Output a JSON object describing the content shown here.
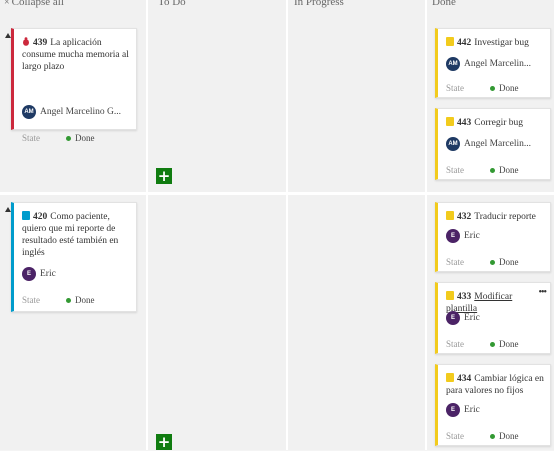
{
  "header": {
    "collapse_all": "Collapse all",
    "collapse_icon": "×",
    "columns": [
      "To Do",
      "In Progress",
      "Done"
    ]
  },
  "state_label": "State",
  "colors": {
    "bug": "#cc293d",
    "story": "#009ccc",
    "task": "#f2cb1d",
    "done_dot": "#339933",
    "add_button": "#107c10"
  },
  "rows": [
    {
      "parent": {
        "type": "bug",
        "icon": "bug-icon",
        "id": "439",
        "title": "La aplicación consume mucha memoria al largo plazo",
        "assignee_initials": "AM",
        "assignee": "Angel Marcelino G...",
        "state": "Done"
      },
      "done": [
        {
          "id": "442",
          "title": "Investigar bug",
          "initials": "AM",
          "assignee": "Angel Marcelin...",
          "state": "Done"
        },
        {
          "id": "443",
          "title": "Corregir bug",
          "initials": "AM",
          "assignee": "Angel Marcelin...",
          "state": "Done"
        }
      ]
    },
    {
      "parent": {
        "type": "story",
        "icon": "book-icon",
        "id": "420",
        "title": "Como paciente, quiero que mi reporte de resultado esté también en inglés",
        "assignee_initials": "E",
        "assignee": "Eric",
        "state": "Done"
      },
      "done": [
        {
          "id": "432",
          "title": "Traducir reporte",
          "initials": "E",
          "assignee": "Eric",
          "state": "Done"
        },
        {
          "id": "433",
          "title": "Modificar plantilla",
          "initials": "E",
          "assignee": "Eric",
          "state": "Done",
          "more": "•••"
        },
        {
          "id": "434",
          "title": "Cambiar lógica en para valores no fijos",
          "initials": "E",
          "assignee": "Eric",
          "state": "Done"
        }
      ]
    }
  ],
  "add_button_label": "+"
}
